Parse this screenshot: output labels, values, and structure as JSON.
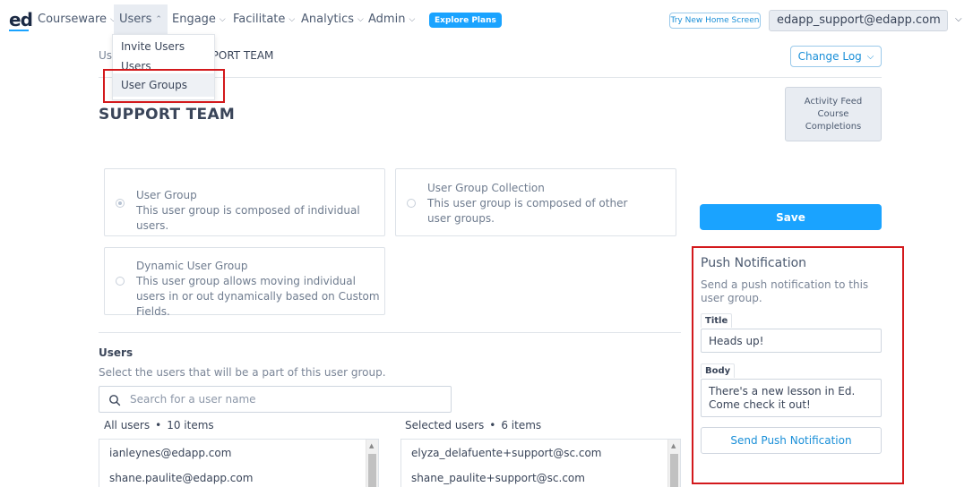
{
  "nav": {
    "logo": "ed",
    "items": [
      {
        "label": "Courseware"
      },
      {
        "label": "Users"
      },
      {
        "label": "Engage"
      },
      {
        "label": "Facilitate"
      },
      {
        "label": "Analytics"
      },
      {
        "label": "Admin"
      }
    ],
    "explore_label": "Explore Plans",
    "try_home_label": "Try New Home Screen",
    "account_email": "edapp_support@edapp.com"
  },
  "users_menu": {
    "items": [
      {
        "label": "Invite Users"
      },
      {
        "label": "Users"
      },
      {
        "label": "User Groups"
      }
    ]
  },
  "breadcrumb": {
    "root": "Users",
    "current": "SUPPORT TEAM"
  },
  "change_log_label": "Change Log",
  "page_title": "SUPPORT TEAM",
  "activity_feed": {
    "lines": [
      "Activity Feed",
      "Course",
      "Completions"
    ]
  },
  "group_types": [
    {
      "title": "User Group",
      "desc": "This user group is composed of individual users.",
      "selected": true
    },
    {
      "title": "User Group Collection",
      "desc": "This user group is composed of other user groups.",
      "selected": false
    },
    {
      "title": "Dynamic User Group",
      "desc": "This user group allows moving individual users in or out dynamically based on Custom Fields.",
      "selected": false
    }
  ],
  "save_label": "Save",
  "push": {
    "title": "Push Notification",
    "desc": "Send a push notification to this user group.",
    "title_label": "Title",
    "title_value": "Heads up!",
    "body_label": "Body",
    "body_value": "There's a new lesson in Ed. Come check it out!",
    "send_label": "Send Push Notification"
  },
  "users_section": {
    "heading": "Users",
    "subtitle": "Select the users that will be a part of this user group.",
    "search_placeholder": "Search for a user name",
    "all_label": "All users",
    "all_count": "10 items",
    "selected_label": "Selected users",
    "selected_count": "6 items",
    "all_users": [
      "ianleynes@edapp.com",
      "shane.paulite@edapp.com"
    ],
    "selected_users": [
      "elyza_delafuente+support@sc.com",
      "shane_paulite+support@sc.com"
    ]
  },
  "colors": {
    "accent": "#1aa3ff",
    "highlight_box": "#d3191c"
  }
}
